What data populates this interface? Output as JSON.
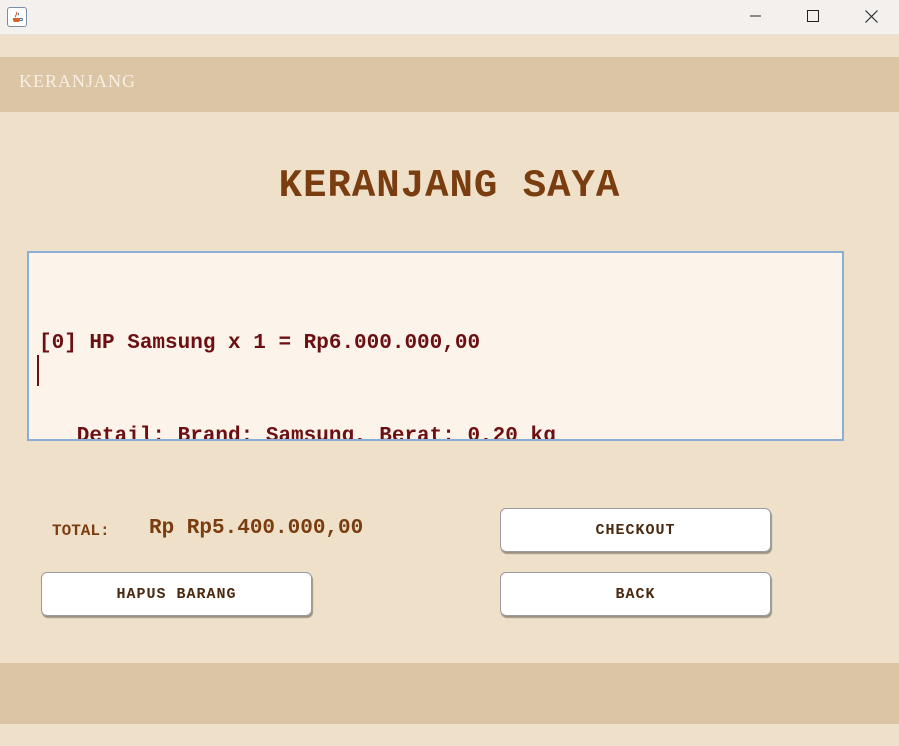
{
  "window": {
    "minimize_glyph": "—",
    "maximize_glyph": "☐",
    "close_glyph": "✕",
    "app_icon": "java-coffee-icon"
  },
  "header": {
    "label": "KERANJANG"
  },
  "page": {
    "title": "KERANJANG SAYA"
  },
  "cart": {
    "lines": [
      "[0] HP Samsung x 1 = Rp6.000.000,00",
      "   Detail: Brand: Samsung, Berat: 0,20 kg"
    ]
  },
  "total": {
    "label": "TOTAL:",
    "value": "Rp Rp5.400.000,00"
  },
  "buttons": {
    "checkout": "CHECKOUT",
    "hapus": "HAPUS BARANG",
    "back": "BACK"
  },
  "colors": {
    "background": "#efe0ca",
    "band": "#dcc5a5",
    "title_text": "#7a3d10",
    "cart_text": "#6b0f12",
    "cart_border": "#8aaed4"
  }
}
